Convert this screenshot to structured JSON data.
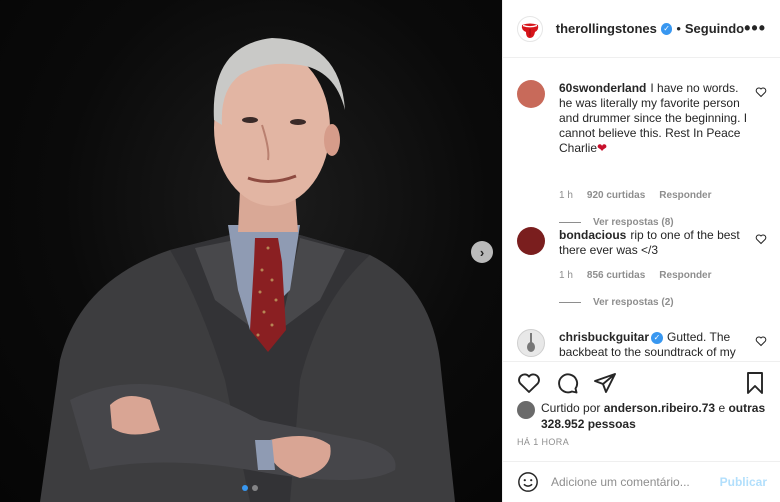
{
  "post": {
    "account": "therollingstones",
    "verified": true,
    "separator": "•",
    "follow_label": "Seguindo",
    "more_label": "•••"
  },
  "comments": [
    {
      "user": "60swonderland",
      "text": "I have no words. he was literally my favorite person and drummer since the beginning. I cannot believe this. Rest In Peace Charlie",
      "emoji": "❤",
      "time": "1 h",
      "likes": "920 curtidas",
      "reply_label": "Responder",
      "replies_label": "Ver respostas (8)",
      "avatar_color": "#c86a5a"
    },
    {
      "user": "bondacious",
      "text": "rip to one of the best there ever was </3",
      "time": "1 h",
      "likes": "856 curtidas",
      "reply_label": "Responder",
      "replies_label": "Ver respostas (2)",
      "avatar_color": "#7a1e1e"
    },
    {
      "user": "chrisbuckguitar",
      "verified": true,
      "text": "Gutted. The backbeat to the soundtrack of my",
      "avatar_color": "#9a9a9a"
    }
  ],
  "liked_by": {
    "prefix": "Curtido por",
    "user": "anderson.ribeiro.73",
    "conj": "e",
    "others": "outras 328.952 pessoas"
  },
  "timestamp": "HÁ 1 HORA",
  "comment_box": {
    "placeholder": "Adicione um comentário...",
    "publish_label": "Publicar"
  },
  "carousel": {
    "current": 1,
    "total": 2
  },
  "colors": {
    "accent": "#3897f0",
    "publish_disabled": "#b2dffc",
    "logo_red": "#d7141a"
  }
}
